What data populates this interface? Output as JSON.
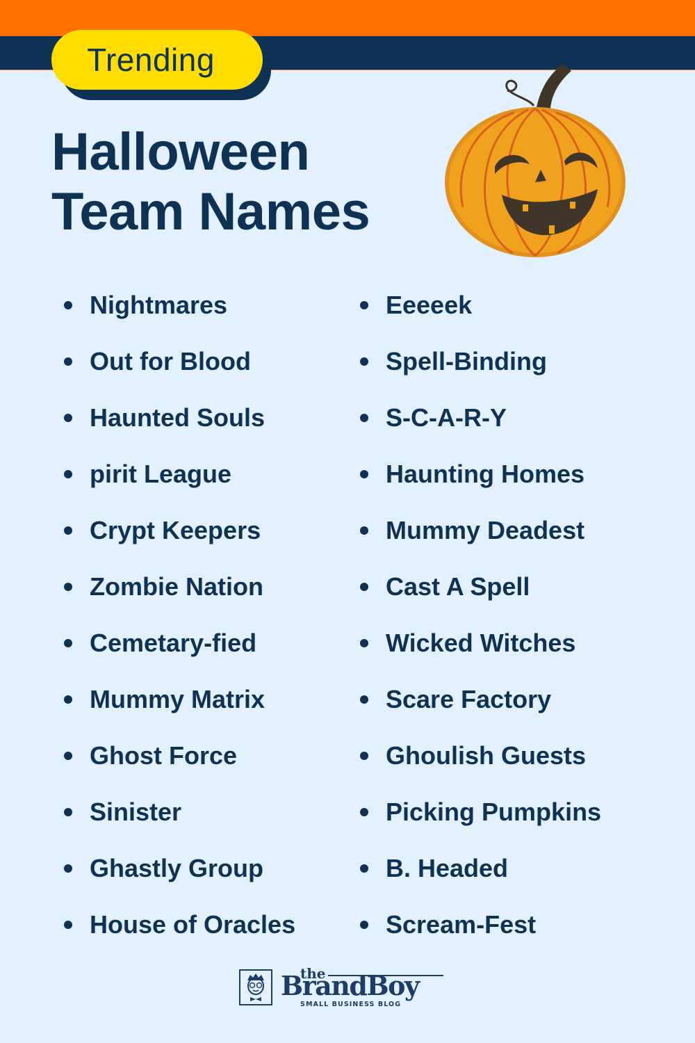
{
  "header": {
    "badge_label": "Trending",
    "title_line1": "Halloween",
    "title_line2": "Team Names"
  },
  "colors": {
    "background": "#e3f0fe",
    "top_bar_orange": "#ff7200",
    "top_bar_navy": "#0e3253",
    "badge_yellow": "#ffdd00",
    "text_navy": "#0e3253",
    "pumpkin_orange": "#f0a020"
  },
  "illustration": {
    "icon": "jack-o-lantern-icon"
  },
  "names": {
    "left": [
      "Nightmares",
      "Out for Blood",
      "Haunted Souls",
      "pirit League",
      "Crypt Keepers",
      "Zombie Nation",
      "Cemetary-fied",
      "Mummy Matrix",
      "Ghost Force",
      "Sinister",
      "Ghastly Group",
      "House of Oracles"
    ],
    "right": [
      "Eeeeek",
      "Spell-Binding",
      "S-C-A-R-Y",
      "Haunting Homes",
      "Mummy Deadest",
      "Cast A Spell",
      "Wicked Witches",
      "Scare Factory",
      "Ghoulish Guests",
      "Picking Pumpkins",
      "B. Headed",
      "Scream-Fest"
    ]
  },
  "footer": {
    "logo_the": "the",
    "logo_brand": "BrandBoy",
    "logo_tagline": "SMALL BUSINESS BLOG",
    "logo_icon": "boy-mascot-icon"
  }
}
